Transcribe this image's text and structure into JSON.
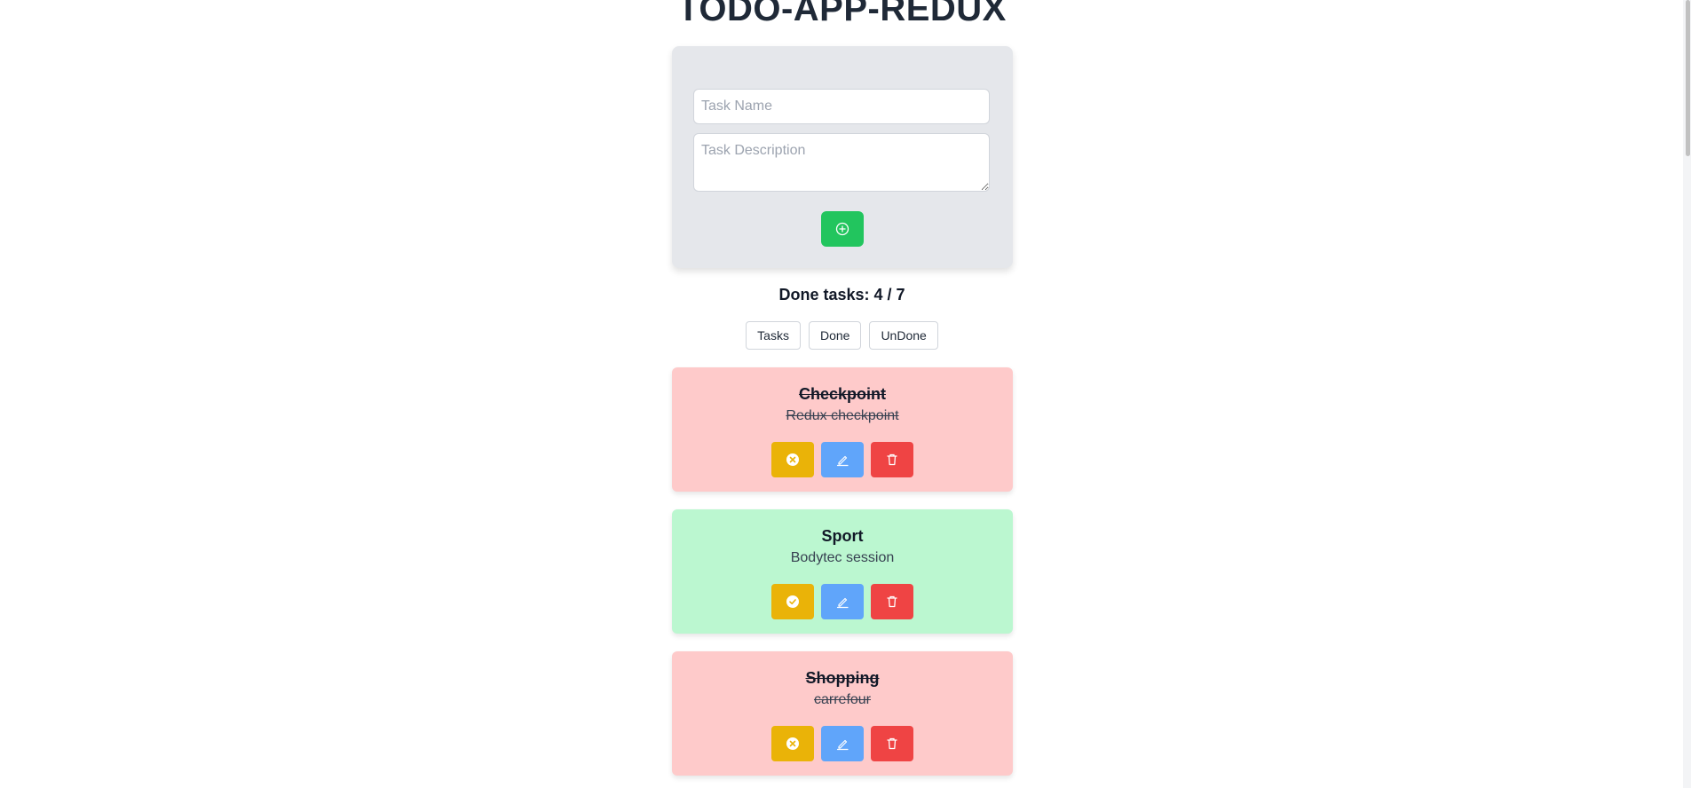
{
  "app": {
    "title": "TODO-APP-REDUX"
  },
  "form": {
    "task_name_placeholder": "Task Name",
    "task_name_value": "",
    "task_desc_placeholder": "Task Description",
    "task_desc_value": "",
    "add_icon": "plus-circle-icon"
  },
  "summary": {
    "done_text": "Done tasks: 4 / 7"
  },
  "filters": [
    {
      "label": "Tasks"
    },
    {
      "label": "Done"
    },
    {
      "label": "UnDone"
    }
  ],
  "tasks": [
    {
      "title": "Checkpoint",
      "description": "Redux checkpoint",
      "done": true,
      "toggle_icon": "x-circle-icon"
    },
    {
      "title": "Sport",
      "description": "Bodytec session",
      "done": false,
      "toggle_icon": "check-circle-icon"
    },
    {
      "title": "Shopping",
      "description": "carrefour",
      "done": true,
      "toggle_icon": "x-circle-icon"
    }
  ],
  "colors": {
    "done_card": "#fecaca",
    "undone_card": "#bbf7d0",
    "add_button": "#22c55e",
    "toggle_button": "#eab308",
    "edit_button": "#60a5fa",
    "delete_button": "#ef4444"
  }
}
